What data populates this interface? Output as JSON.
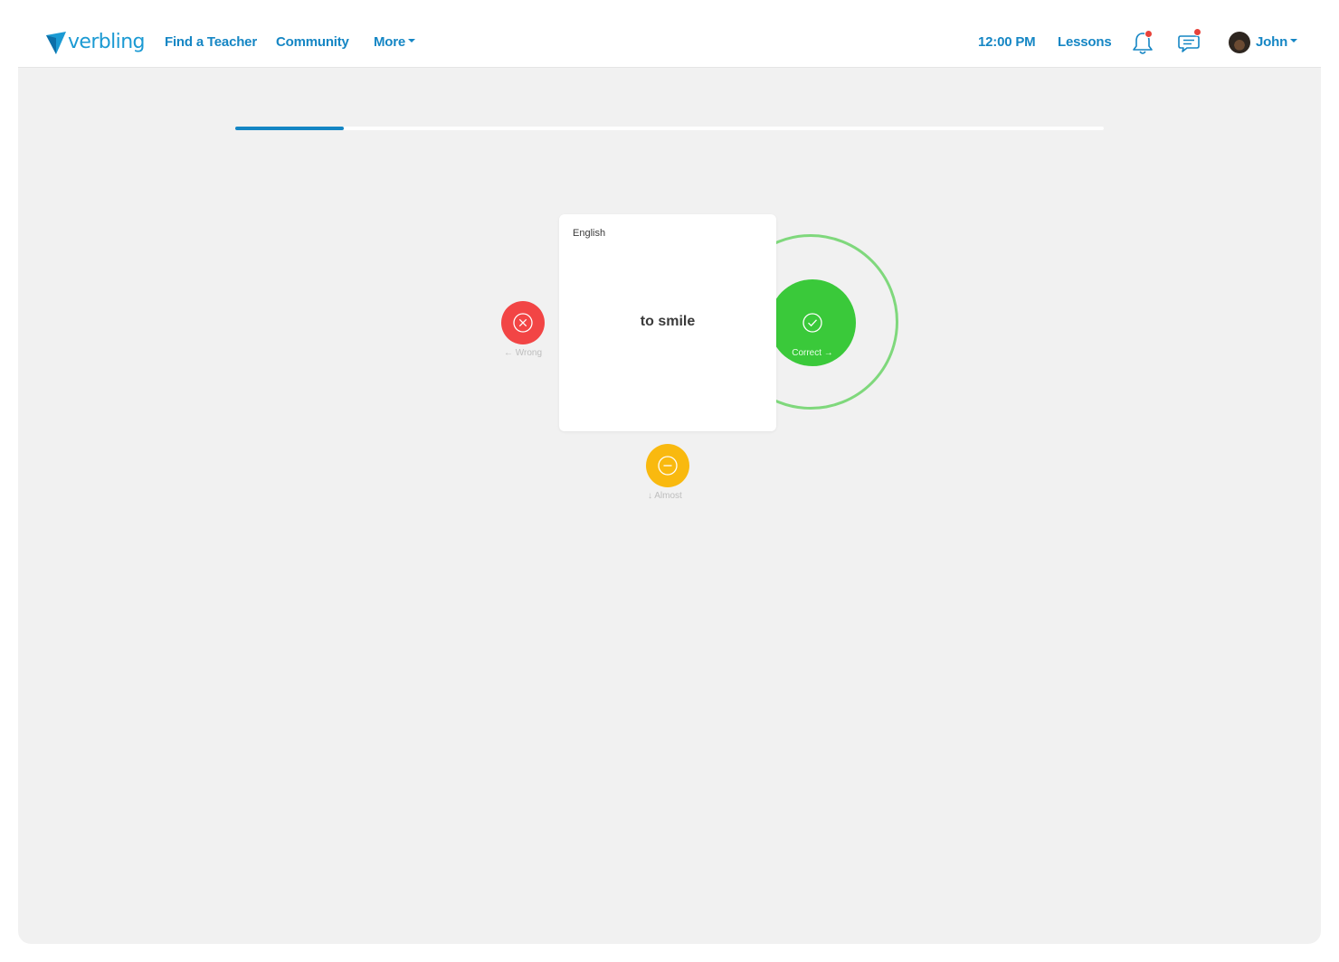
{
  "navbar": {
    "logo_text": "verbling",
    "links": {
      "find_teacher": "Find a Teacher",
      "community": "Community",
      "more": "More"
    },
    "time": "12:00 PM",
    "lessons": "Lessons",
    "notifications_icon": "bell-icon",
    "messages_icon": "chat-bubble-icon",
    "user_name": "John",
    "accent_color": "#1586c4",
    "badge_color": "#e8423a"
  },
  "progress": {
    "fraction": 0.125
  },
  "flashcard": {
    "language": "English",
    "word": "to smile"
  },
  "answers": {
    "wrong": {
      "label": "← Wrong",
      "icon": "x-circle-icon",
      "color": "#f24545"
    },
    "correct": {
      "label": "Correct →",
      "icon": "check-circle-icon",
      "color": "#3ac93a"
    },
    "almost": {
      "label": "↓ Almost",
      "icon": "minus-circle-icon",
      "color": "#f9b90f"
    }
  }
}
